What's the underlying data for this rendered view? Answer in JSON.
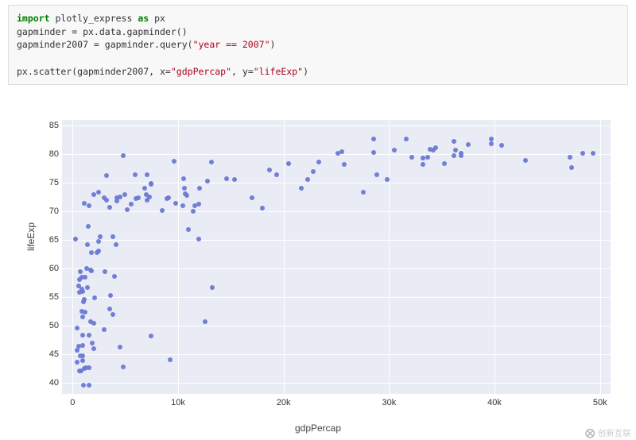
{
  "code": {
    "kw_import": "import",
    "mod": " plotly_express ",
    "kw_as": "as",
    "alias": " px",
    "l2": "gapminder = px.data.gapminder()",
    "l3a": "gapminder2007 = gapminder.query(",
    "l3s": "\"year == 2007\"",
    "l3b": ")",
    "l5a": "px.scatter(gapminder2007, x=",
    "l5s1": "\"gdpPercap\"",
    "l5b": ", y=",
    "l5s2": "\"lifeExp\"",
    "l5c": ")"
  },
  "chart_data": {
    "type": "scatter",
    "xlabel": "gdpPercap",
    "ylabel": "lifeExp",
    "xlim": [
      -1000,
      51000
    ],
    "ylim": [
      38,
      86
    ],
    "xticks": [
      0,
      10000,
      20000,
      30000,
      40000,
      50000
    ],
    "xtick_labels": [
      "0",
      "10k",
      "20k",
      "30k",
      "40k",
      "50k"
    ],
    "yticks": [
      40,
      45,
      50,
      55,
      60,
      65,
      70,
      75,
      80,
      85
    ],
    "points": [
      [
        974,
        43.8
      ],
      [
        5937,
        76.4
      ],
      [
        6223,
        72.3
      ],
      [
        4797,
        42.7
      ],
      [
        12779,
        75.3
      ],
      [
        34435,
        81.2
      ],
      [
        36126,
        79.8
      ],
      [
        29796,
        75.6
      ],
      [
        1391,
        64.1
      ],
      [
        33693,
        79.4
      ],
      [
        1441,
        56.7
      ],
      [
        3822,
        65.6
      ],
      [
        7446,
        74.9
      ],
      [
        12570,
        50.7
      ],
      [
        9066,
        72.4
      ],
      [
        10681,
        73.0
      ],
      [
        1217,
        52.3
      ],
      [
        430,
        49.6
      ],
      [
        1713,
        59.7
      ],
      [
        2042,
        50.4
      ],
      [
        36319,
        80.7
      ],
      [
        706,
        44.7
      ],
      [
        1704,
        50.7
      ],
      [
        13172,
        78.6
      ],
      [
        4959,
        72.9
      ],
      [
        7006,
        72.9
      ],
      [
        986,
        46.5
      ],
      [
        277,
        65.2
      ],
      [
        3633,
        55.3
      ],
      [
        9645,
        78.8
      ],
      [
        1544,
        48.3
      ],
      [
        14619,
        75.7
      ],
      [
        8948,
        72.2
      ],
      [
        22833,
        77.0
      ],
      [
        35278,
        78.3
      ],
      [
        2082,
        54.8
      ],
      [
        6025,
        72.2
      ],
      [
        6873,
        74.0
      ],
      [
        5581,
        71.3
      ],
      [
        7093,
        71.9
      ],
      [
        641,
        55.8
      ],
      [
        690,
        58.0
      ],
      [
        33207,
        79.3
      ],
      [
        30470,
        80.7
      ],
      [
        13206,
        56.7
      ],
      [
        752,
        59.4
      ],
      [
        32170,
        79.4
      ],
      [
        1328,
        60.0
      ],
      [
        27538,
        73.3
      ],
      [
        5186,
        70.3
      ],
      [
        942,
        56.0
      ],
      [
        579,
        46.4
      ],
      [
        1201,
        58.4
      ],
      [
        3548,
        52.9
      ],
      [
        39725,
        81.8
      ],
      [
        18009,
        70.6
      ],
      [
        36181,
        82.2
      ],
      [
        2452,
        64.7
      ],
      [
        3541,
        70.7
      ],
      [
        11606,
        71.0
      ],
      [
        40676,
        81.5
      ],
      [
        25523,
        80.5
      ],
      [
        28569,
        82.6
      ],
      [
        7321,
        72.5
      ],
      [
        31656,
        82.6
      ],
      [
        4519,
        72.5
      ],
      [
        1463,
        67.3
      ],
      [
        1593,
        71.0
      ],
      [
        23348,
        78.6
      ],
      [
        47307,
        77.6
      ],
      [
        10461,
        71.0
      ],
      [
        1569,
        42.6
      ],
      [
        414,
        45.7
      ],
      [
        12057,
        74.0
      ],
      [
        3096,
        59.4
      ],
      [
        10957,
        66.8
      ],
      [
        986,
        48.3
      ],
      [
        1044,
        54.1
      ],
      [
        636,
        42.1
      ],
      [
        4128,
        64.2
      ],
      [
        1803,
        59.5
      ],
      [
        11977,
        71.2
      ],
      [
        3190,
        76.2
      ],
      [
        2453,
        63.1
      ],
      [
        823,
        42.1
      ],
      [
        944,
        44.7
      ],
      [
        4811,
        79.8
      ],
      [
        619,
        56.9
      ],
      [
        36798,
        79.8
      ],
      [
        25185,
        80.2
      ],
      [
        2014,
        72.9
      ],
      [
        1091,
        54.5
      ],
      [
        1828,
        46.9
      ],
      [
        36798,
        80.2
      ],
      [
        22316,
        75.6
      ],
      [
        2606,
        65.5
      ],
      [
        9809,
        71.4
      ],
      [
        4173,
        71.8
      ],
      [
        3190,
        72.0
      ],
      [
        7409,
        74.7
      ],
      [
        1107,
        71.4
      ],
      [
        2013,
        45.9
      ],
      [
        20510,
        78.3
      ],
      [
        15390,
        75.5
      ],
      [
        19328,
        76.4
      ],
      [
        10808,
        72.8
      ],
      [
        4513,
        46.2
      ],
      [
        33860,
        80.9
      ],
      [
        37506,
        81.7
      ],
      [
        1803,
        62.7
      ],
      [
        1271,
        42.6
      ],
      [
        863,
        52.5
      ],
      [
        21655,
        74.1
      ],
      [
        34167,
        80.7
      ],
      [
        9270,
        44.0
      ],
      [
        7458,
        48.2
      ],
      [
        3025,
        72.4
      ],
      [
        28821,
        76.4
      ],
      [
        1107,
        42.4
      ],
      [
        1569,
        39.6
      ],
      [
        882,
        58.4
      ],
      [
        47143,
        79.4
      ],
      [
        18678,
        77.2
      ],
      [
        25768,
        78.2
      ],
      [
        926,
        51.5
      ],
      [
        28569,
        80.3
      ],
      [
        4184,
        72.3
      ],
      [
        3970,
        58.6
      ],
      [
        16999,
        72.3
      ],
      [
        896,
        56.4
      ],
      [
        8458,
        70.2
      ],
      [
        10611,
        74.0
      ],
      [
        11416,
        70.0
      ],
      [
        11978,
        65.2
      ],
      [
        42952,
        78.9
      ],
      [
        10501,
        75.7
      ],
      [
        2442,
        73.4
      ],
      [
        2281,
        62.7
      ],
      [
        469,
        43.5
      ],
      [
        3025,
        49.3
      ],
      [
        33203,
        78.2
      ],
      [
        3820,
        51.9
      ],
      [
        39725,
        82.6
      ],
      [
        1057,
        39.6
      ],
      [
        7093,
        76.4
      ],
      [
        48357,
        80.2
      ],
      [
        49357,
        80.1
      ]
    ]
  },
  "watermark": "创新互联"
}
